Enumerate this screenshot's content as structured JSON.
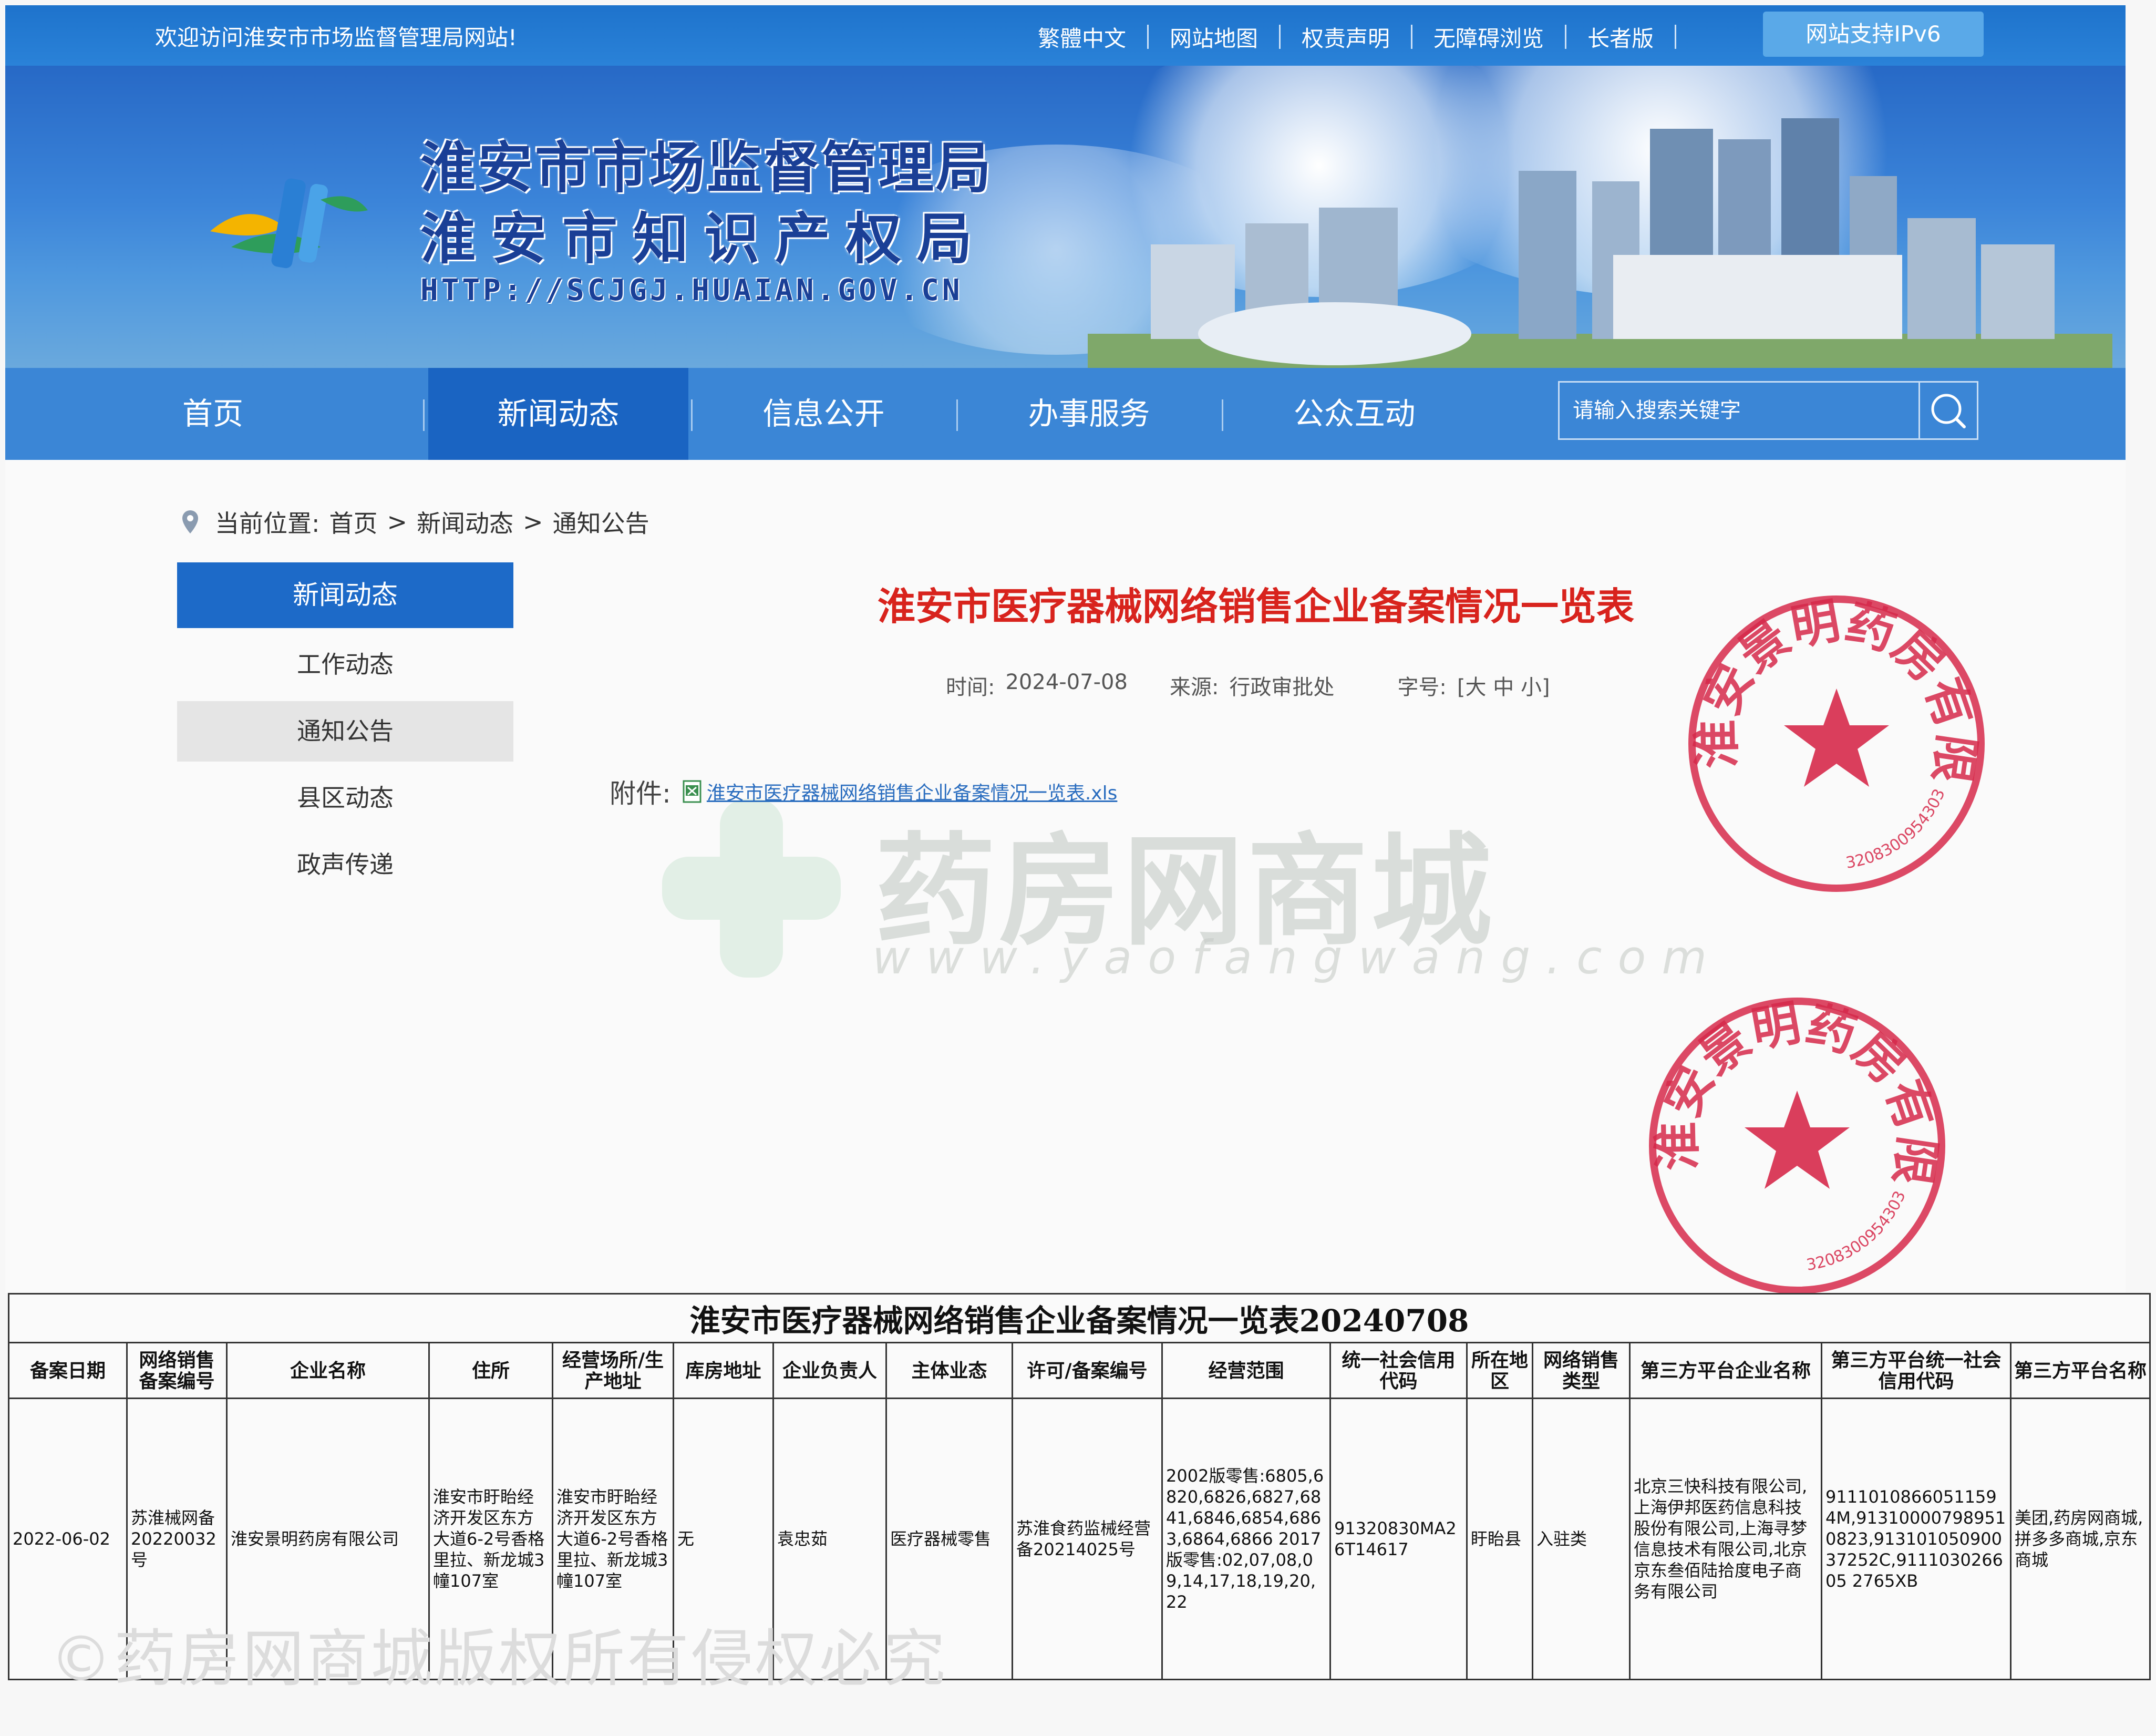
{
  "topbar": {
    "welcome": "欢迎访问淮安市市场监督管理局网站!",
    "links": [
      "繁體中文",
      "网站地图",
      "权责声明",
      "无障碍浏览",
      "长者版"
    ],
    "ipv6": "网站支持IPv6"
  },
  "banner": {
    "title1": "淮安市市场监督管理局",
    "title2": "淮安市知识产权局",
    "url": "HTTP://SCJGJ.HUAIAN.GOV.CN"
  },
  "nav": {
    "items": [
      "首页",
      "新闻动态",
      "信息公开",
      "办事服务",
      "公众互动"
    ],
    "active": "新闻动态",
    "search_placeholder": "请输入搜索关键字"
  },
  "breadcrumb": {
    "label": "当前位置:",
    "items": [
      "首页",
      "新闻动态",
      "通知公告"
    ],
    "sep": ">"
  },
  "sidebar": {
    "header": "新闻动态",
    "items": [
      "工作动态",
      "通知公告",
      "县区动态",
      "政声传递"
    ],
    "current": "通知公告"
  },
  "article": {
    "title": "淮安市医疗器械网络销售企业备案情况一览表",
    "time_label": "时间:",
    "time": "2024-07-08",
    "source_label": "来源:",
    "source": "行政审批处",
    "size_label": "字号:",
    "size_opts": "[大 中 小]",
    "attach_label": "附件:",
    "attach_file": "淮安市医疗器械网络销售企业备案情况一览表.xls"
  },
  "watermark": {
    "text": "药房网商城",
    "url": "www.yaofangwang.com",
    "copyright": "©药房网商城版权所有侵权必究"
  },
  "seal": {
    "company": "淮安景明药房有限公司",
    "code": "3208300954303"
  },
  "table": {
    "caption": "淮安市医疗器械网络销售企业备案情况一览表20240708",
    "headers": [
      "备案日期",
      "网络销售备案编号",
      "企业名称",
      "住所",
      "经营场所/生产地址",
      "库房地址",
      "企业负责人",
      "主体业态",
      "许可/备案编号",
      "经营范围",
      "统一社会信用代码",
      "所在地区",
      "网络销售类型",
      "第三方平台企业名称",
      "第三方平台统一社会信用代码",
      "第三方平台名称"
    ],
    "row": [
      "2022-06-02",
      "苏淮械网备20220032号",
      "淮安景明药房有限公司",
      "淮安市盱眙经济开发区东方大道6-2号香格里拉、新龙城3幢107室",
      "淮安市盱眙经济开发区东方大道6-2号香格里拉、新龙城3幢107室",
      "无",
      "袁忠茹",
      "医疗器械零售",
      "苏淮食药监械经营备20214025号",
      "2002版零售:6805,6820,6826,6827,6841,6846,6854,6863,6864,6866 2017版零售:02,07,08,09,14,17,18,19,20,22",
      "91320830MA26T14617",
      "盱眙县",
      "入驻类",
      "北京三快科技有限公司,上海伊邦医药信息科技股份有限公司,上海寻梦信息技术有限公司,北京京东叁佰陆拾度电子商务有限公司",
      "91110108660511594M,913100007989510823,91310105090037252C,911103026605 2765XB",
      "美团,药房网商城,拼多多商城,京东商城"
    ]
  },
  "colors": {
    "brand": "#1d6ac8",
    "nav": "#3b86d6",
    "title_red": "#d8231d",
    "seal_red": "#d6294a"
  }
}
